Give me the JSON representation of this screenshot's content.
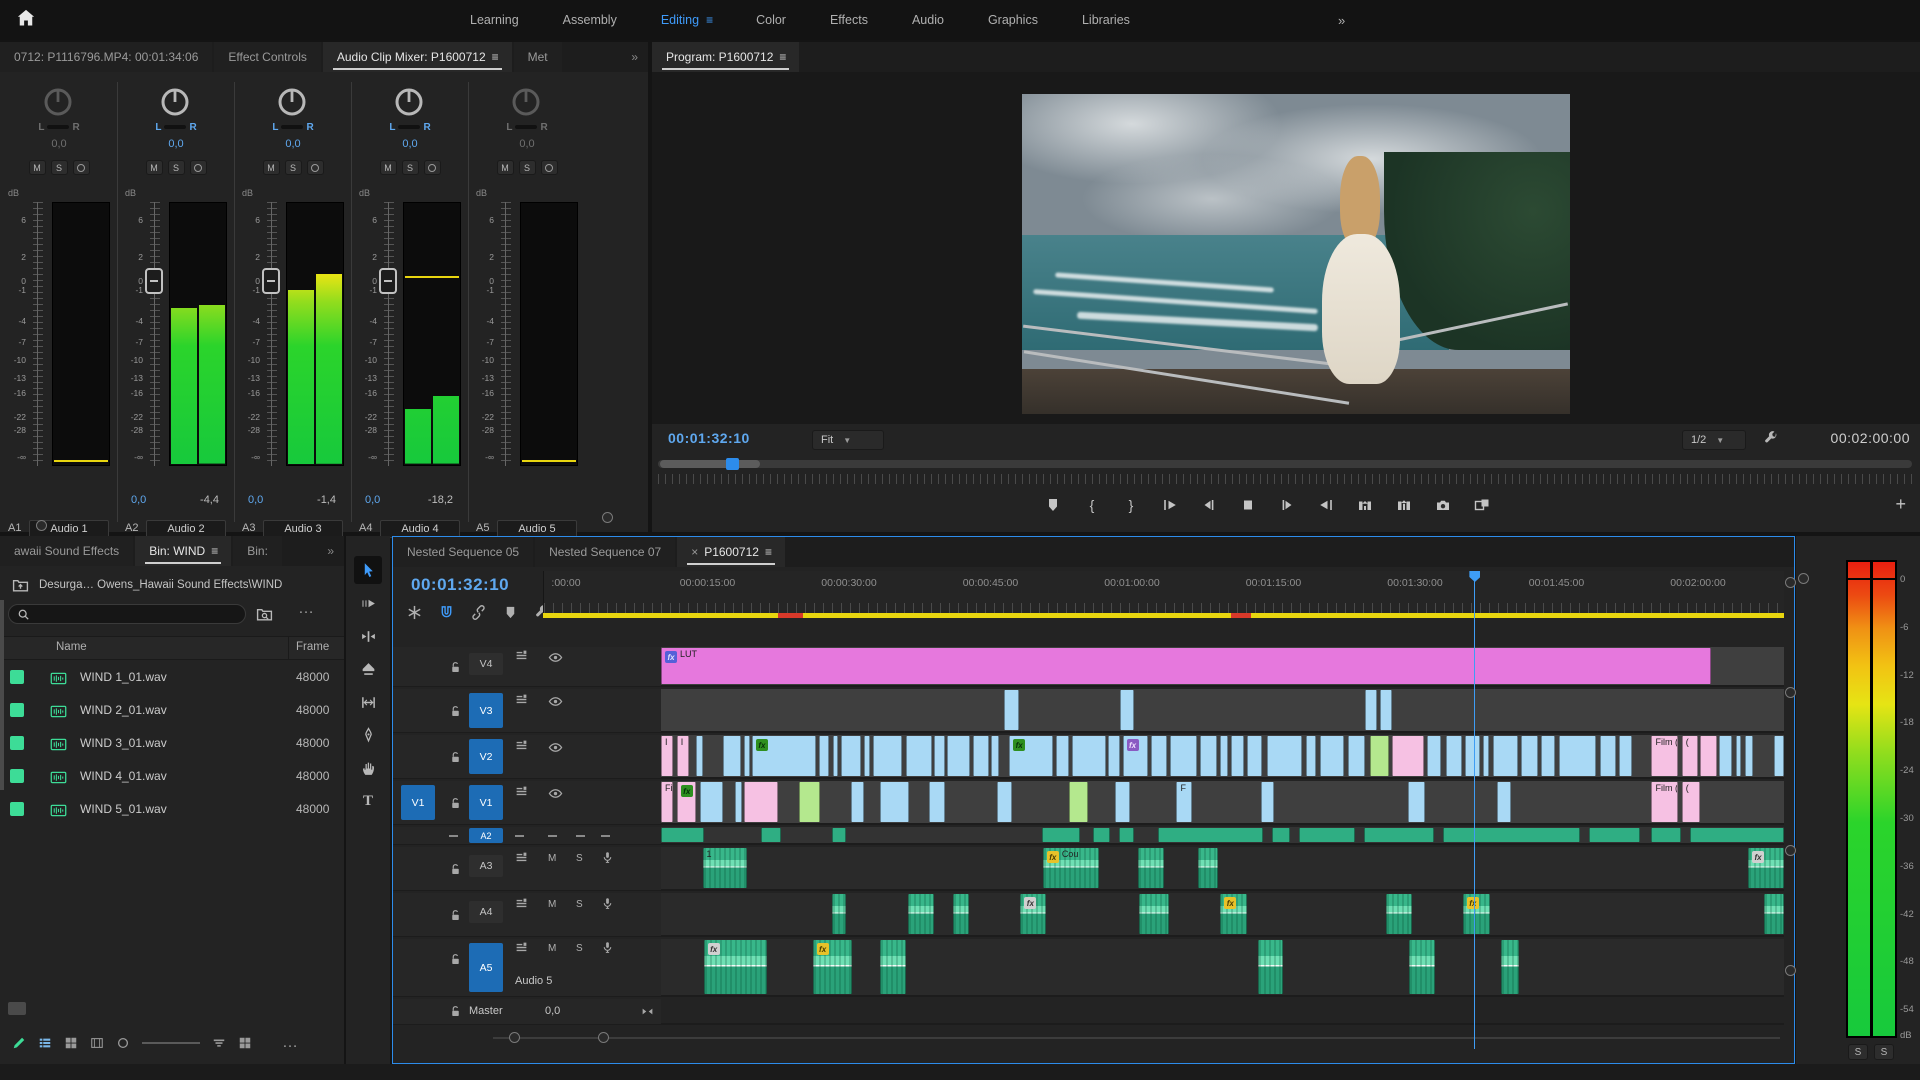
{
  "topbar": {
    "workspace_tabs": [
      {
        "label": "Learning",
        "active": false
      },
      {
        "label": "Assembly",
        "active": false
      },
      {
        "label": "Editing",
        "active": true
      },
      {
        "label": "Color",
        "active": false
      },
      {
        "label": "Effects",
        "active": false
      },
      {
        "label": "Audio",
        "active": false
      },
      {
        "label": "Graphics",
        "active": false
      },
      {
        "label": "Libraries",
        "active": false
      }
    ],
    "overflow": "»"
  },
  "mixer": {
    "tabs": [
      {
        "label": "0712: P1116796.MP4: 00:01:34:06",
        "active": false
      },
      {
        "label": "Effect Controls",
        "active": false
      },
      {
        "label": "Audio Clip Mixer: P1600712",
        "active": true,
        "menu": true
      },
      {
        "label": "Met",
        "active": false
      }
    ],
    "overflow": "»",
    "db_unit": "dB",
    "pan_left": "L",
    "pan_right": "R",
    "scale": [
      "6",
      "2",
      "0",
      "-1",
      "-4",
      "-7",
      "-10",
      "-13",
      "-16",
      "-22",
      "-28"
    ],
    "neg_inf": "-∞",
    "mute_label": "M",
    "solo_label": "S",
    "strips": [
      {
        "id": "A1",
        "name": "Audio 1",
        "pan": "0,0",
        "active": false,
        "meter_l": 0,
        "meter_r": 0,
        "bottom_peak_line": true,
        "fader": null,
        "peak": null
      },
      {
        "id": "A2",
        "name": "Audio 2",
        "pan": "0,0",
        "active": true,
        "meter_l": 0.6,
        "meter_r": 0.61,
        "fader": "0,0",
        "peak": "-4,4"
      },
      {
        "id": "A3",
        "name": "Audio 3",
        "pan": "0,0",
        "active": true,
        "meter_l": 0.67,
        "meter_r": 0.73,
        "fader": "0,0",
        "peak": "-1,4"
      },
      {
        "id": "A4",
        "name": "Audio 4",
        "pan": "0,0",
        "active": true,
        "meter_l": 0.21,
        "meter_r": 0.26,
        "peak_line": 0.28,
        "fader": "0,0",
        "peak": "-18,2"
      },
      {
        "id": "A5",
        "name": "Audio 5",
        "pan": "0,0",
        "active": false,
        "meter_l": 0,
        "meter_r": 0,
        "bottom_peak_line": true,
        "fader": null,
        "peak": null
      }
    ]
  },
  "program": {
    "tab": "Program: P1600712",
    "timecode": "00:01:32:10",
    "zoom_select": "Fit",
    "playback_resolution": "1/2",
    "duration": "00:02:00:00",
    "transport": [
      "add-marker",
      "mark-in",
      "mark-out",
      "go-to-in",
      "step-back",
      "play-stop",
      "step-forward",
      "go-to-out",
      "lift",
      "extract",
      "export-frame",
      "comparison-view"
    ],
    "add_button": "+"
  },
  "project": {
    "tabs": [
      {
        "label": "awaii Sound Effects",
        "active": false
      },
      {
        "label": "Bin: WIND",
        "active": true,
        "menu": true
      },
      {
        "label": "Bin:",
        "active": false
      }
    ],
    "overflow": "»",
    "path": "Desurga… Owens_Hawaii Sound Effects\\WIND",
    "columns": [
      "Name",
      "Frame"
    ],
    "files": [
      {
        "name": "WIND 1_01.wav",
        "frame_rate": "48000"
      },
      {
        "name": "WIND 2_01.wav",
        "frame_rate": "48000"
      },
      {
        "name": "WIND 3_01.wav",
        "frame_rate": "48000"
      },
      {
        "name": "WIND 4_01.wav",
        "frame_rate": "48000"
      },
      {
        "name": "WIND 5_01.wav",
        "frame_rate": "48000"
      }
    ],
    "bottom_icons": [
      "project-writable",
      "list-view",
      "icon-view",
      "freeform-view",
      "zoom-out",
      "zoom-slider",
      "sort-icon",
      "view-options",
      "more"
    ]
  },
  "tools": [
    "selection",
    "track-select-forward",
    "ripple-edit",
    "razor",
    "slip",
    "pen",
    "hand",
    "type"
  ],
  "timeline": {
    "tabs": [
      {
        "label": "Nested Sequence 05",
        "active": false
      },
      {
        "label": "Nested Sequence 07",
        "active": false
      },
      {
        "label": "P1600712",
        "active": true,
        "closable": true,
        "menu": true
      }
    ],
    "timecode": "00:01:32:10",
    "toolbar": [
      "nest",
      "snap",
      "linked-selection",
      "add-marker",
      "timeline-settings"
    ],
    "ruler_labels": [
      ":00:00",
      "00:00:15:00",
      "00:00:30:00",
      "00:00:45:00",
      "00:01:00:00",
      "00:01:15:00",
      "00:01:30:00",
      "00:01:45:00",
      "00:02:00:00"
    ],
    "playhead_pct": 72.3,
    "mute_label": "M",
    "solo_label": "S",
    "video_tracks": [
      {
        "id": "V4",
        "targeted": false
      },
      {
        "id": "V3",
        "targeted": true
      },
      {
        "id": "V2",
        "targeted": true
      },
      {
        "id": "V1",
        "targeted": true,
        "source_patch": "V1"
      }
    ],
    "audio_tracks": [
      {
        "id": "A2",
        "squeezed": true,
        "targeted": true
      },
      {
        "id": "A3",
        "targeted": false
      },
      {
        "id": "A4",
        "targeted": false
      },
      {
        "id": "A5",
        "targeted": true,
        "name": "Audio 5"
      }
    ],
    "master": {
      "label": "Master",
      "value": "0,0"
    },
    "clips": {
      "V4": [
        {
          "x": 0,
          "w": 93.5,
          "c": "lut",
          "label": "LUT",
          "fx": "blue"
        }
      ],
      "V3": [
        {
          "x": 30.5,
          "w": 1.4,
          "c": "y"
        },
        {
          "x": 40.9,
          "w": 1.2,
          "c": "y"
        },
        {
          "x": 62.7,
          "w": 1.1,
          "c": "y"
        },
        {
          "x": 64.05,
          "w": 1.0,
          "c": "y"
        }
      ],
      "V2": [
        {
          "x": 0,
          "w": 1.1,
          "c": "p",
          "label": "I"
        },
        {
          "x": 1.4,
          "w": 1.1,
          "c": "p",
          "label": "I"
        },
        {
          "x": 3.1,
          "w": 0.6,
          "c": "y"
        },
        {
          "x": 5.5,
          "w": 1.6,
          "c": "y"
        },
        {
          "x": 7.4,
          "w": 0.5,
          "c": "y"
        },
        {
          "x": 8.1,
          "w": 5.7,
          "c": "y",
          "fx": "g"
        },
        {
          "x": 14.1,
          "w": 0.9,
          "c": "y"
        },
        {
          "x": 15.3,
          "w": 0.5,
          "c": "y"
        },
        {
          "x": 16.0,
          "w": 1.8,
          "c": "y"
        },
        {
          "x": 18.1,
          "w": 0.5,
          "c": "y"
        },
        {
          "x": 18.9,
          "w": 2.6,
          "c": "y"
        },
        {
          "x": 21.8,
          "w": 2.3,
          "c": "y"
        },
        {
          "x": 24.3,
          "w": 1.0,
          "c": "y"
        },
        {
          "x": 25.5,
          "w": 2.0,
          "c": "y"
        },
        {
          "x": 27.8,
          "w": 1.4,
          "c": "y"
        },
        {
          "x": 29.4,
          "w": 0.7,
          "c": "y"
        },
        {
          "x": 31.0,
          "w": 3.9,
          "c": "y",
          "fx": "g"
        },
        {
          "x": 35.2,
          "w": 1.1,
          "c": "y"
        },
        {
          "x": 36.6,
          "w": 3.0,
          "c": "y"
        },
        {
          "x": 39.8,
          "w": 1.1,
          "c": "y"
        },
        {
          "x": 41.1,
          "w": 2.3,
          "c": "y",
          "fx": "pu"
        },
        {
          "x": 43.6,
          "w": 1.5,
          "c": "y"
        },
        {
          "x": 45.3,
          "w": 2.4,
          "c": "y"
        },
        {
          "x": 48.0,
          "w": 1.5,
          "c": "y"
        },
        {
          "x": 49.8,
          "w": 0.7,
          "c": "y"
        },
        {
          "x": 50.8,
          "w": 1.1,
          "c": "y"
        },
        {
          "x": 52.2,
          "w": 1.3,
          "c": "y"
        },
        {
          "x": 54.0,
          "w": 3.1,
          "c": "y"
        },
        {
          "x": 57.4,
          "w": 0.9,
          "c": "y"
        },
        {
          "x": 58.7,
          "w": 2.1,
          "c": "y"
        },
        {
          "x": 61.2,
          "w": 1.5,
          "c": "y"
        },
        {
          "x": 63.1,
          "w": 1.7,
          "c": "g"
        },
        {
          "x": 65.1,
          "w": 2.8,
          "c": "p"
        },
        {
          "x": 68.2,
          "w": 1.3,
          "c": "y"
        },
        {
          "x": 69.9,
          "w": 1.4,
          "c": "y"
        },
        {
          "x": 71.6,
          "w": 1.3,
          "c": "y"
        },
        {
          "x": 73.2,
          "w": 0.5,
          "c": "y"
        },
        {
          "x": 74.1,
          "w": 2.2,
          "c": "y"
        },
        {
          "x": 76.6,
          "w": 1.5,
          "c": "y"
        },
        {
          "x": 78.4,
          "w": 1.2,
          "c": "y"
        },
        {
          "x": 80.0,
          "w": 3.3,
          "c": "y"
        },
        {
          "x": 83.6,
          "w": 1.4,
          "c": "y"
        },
        {
          "x": 85.3,
          "w": 1.2,
          "c": "y"
        },
        {
          "x": 88.2,
          "w": 2.4,
          "c": "p",
          "label": "Film ("
        },
        {
          "x": 90.9,
          "w": 1.4,
          "c": "p",
          "label": "("
        },
        {
          "x": 92.5,
          "w": 1.5,
          "c": "p"
        },
        {
          "x": 94.2,
          "w": 1.2,
          "c": "y"
        },
        {
          "x": 95.7,
          "w": 0.5,
          "c": "y"
        },
        {
          "x": 96.5,
          "w": 0.7,
          "c": "y"
        },
        {
          "x": 99.1,
          "w": 0.9,
          "c": "y"
        }
      ],
      "V1": [
        {
          "x": 0,
          "w": 1.1,
          "c": "p",
          "label": "Fil"
        },
        {
          "x": 1.4,
          "w": 1.7,
          "c": "p",
          "fx": "g"
        },
        {
          "x": 3.5,
          "w": 2.0,
          "c": "y"
        },
        {
          "x": 6.6,
          "w": 0.6,
          "c": "y"
        },
        {
          "x": 7.4,
          "w": 3.0,
          "c": "p"
        },
        {
          "x": 12.3,
          "w": 1.9,
          "c": "g"
        },
        {
          "x": 16.9,
          "w": 1.2,
          "c": "y"
        },
        {
          "x": 19.5,
          "w": 2.6,
          "c": "y"
        },
        {
          "x": 23.9,
          "w": 1.4,
          "c": "y"
        },
        {
          "x": 29.9,
          "w": 1.4,
          "c": "y"
        },
        {
          "x": 36.3,
          "w": 1.7,
          "c": "g"
        },
        {
          "x": 40.4,
          "w": 1.4,
          "c": "y"
        },
        {
          "x": 45.9,
          "w": 1.4,
          "c": "y",
          "label": "F"
        },
        {
          "x": 53.4,
          "w": 1.2,
          "c": "y"
        },
        {
          "x": 66.5,
          "w": 1.5,
          "c": "y"
        },
        {
          "x": 74.4,
          "w": 1.3,
          "c": "y"
        },
        {
          "x": 88.2,
          "w": 2.4,
          "c": "p",
          "label": "Film ("
        },
        {
          "x": 90.9,
          "w": 1.6,
          "c": "p",
          "label": "("
        }
      ],
      "A12": [
        {
          "x": 0,
          "w": 3.8
        },
        {
          "x": 8.9,
          "w": 1.8
        },
        {
          "x": 15.2,
          "w": 1.3
        },
        {
          "x": 33.9,
          "w": 3.4
        },
        {
          "x": 38.5,
          "w": 1.5
        },
        {
          "x": 40.8,
          "w": 1.3
        },
        {
          "x": 44.3,
          "w": 9.3
        },
        {
          "x": 54.4,
          "w": 1.6
        },
        {
          "x": 56.8,
          "w": 5.0
        },
        {
          "x": 62.6,
          "w": 6.2
        },
        {
          "x": 69.6,
          "w": 12.2
        },
        {
          "x": 82.6,
          "w": 4.6
        },
        {
          "x": 88.2,
          "w": 2.6
        },
        {
          "x": 91.6,
          "w": 8.4
        }
      ],
      "A3": [
        {
          "x": 3.7,
          "w": 4.0,
          "label": "1"
        },
        {
          "x": 34.0,
          "w": 5.0,
          "label": "Cou",
          "fx": "yl"
        },
        {
          "x": 42.5,
          "w": 2.3
        },
        {
          "x": 47.8,
          "w": 1.8
        },
        {
          "x": 96.8,
          "w": 3.2,
          "fx": "w"
        }
      ],
      "A4": [
        {
          "x": 15.2,
          "w": 1.3
        },
        {
          "x": 22.0,
          "w": 2.3
        },
        {
          "x": 26.0,
          "w": 1.4
        },
        {
          "x": 32.0,
          "w": 2.3,
          "fx": "w"
        },
        {
          "x": 42.6,
          "w": 2.6
        },
        {
          "x": 49.8,
          "w": 2.4,
          "fx": "yl"
        },
        {
          "x": 64.6,
          "w": 2.3
        },
        {
          "x": 71.4,
          "w": 2.4,
          "fx": "yl"
        },
        {
          "x": 98.2,
          "w": 1.8
        }
      ],
      "A5": [
        {
          "x": 3.8,
          "w": 5.6,
          "fx": "w"
        },
        {
          "x": 13.5,
          "w": 3.5,
          "fx": "yl"
        },
        {
          "x": 19.5,
          "w": 2.3
        },
        {
          "x": 53.2,
          "w": 2.2
        },
        {
          "x": 66.6,
          "w": 2.3
        },
        {
          "x": 74.8,
          "w": 1.6
        }
      ]
    }
  },
  "meters": {
    "scale": [
      "0",
      "-6",
      "-12",
      "-18",
      "-24",
      "-30",
      "-36",
      "-42",
      "-48",
      "-54"
    ],
    "unit": "dB",
    "solo": "S"
  }
}
